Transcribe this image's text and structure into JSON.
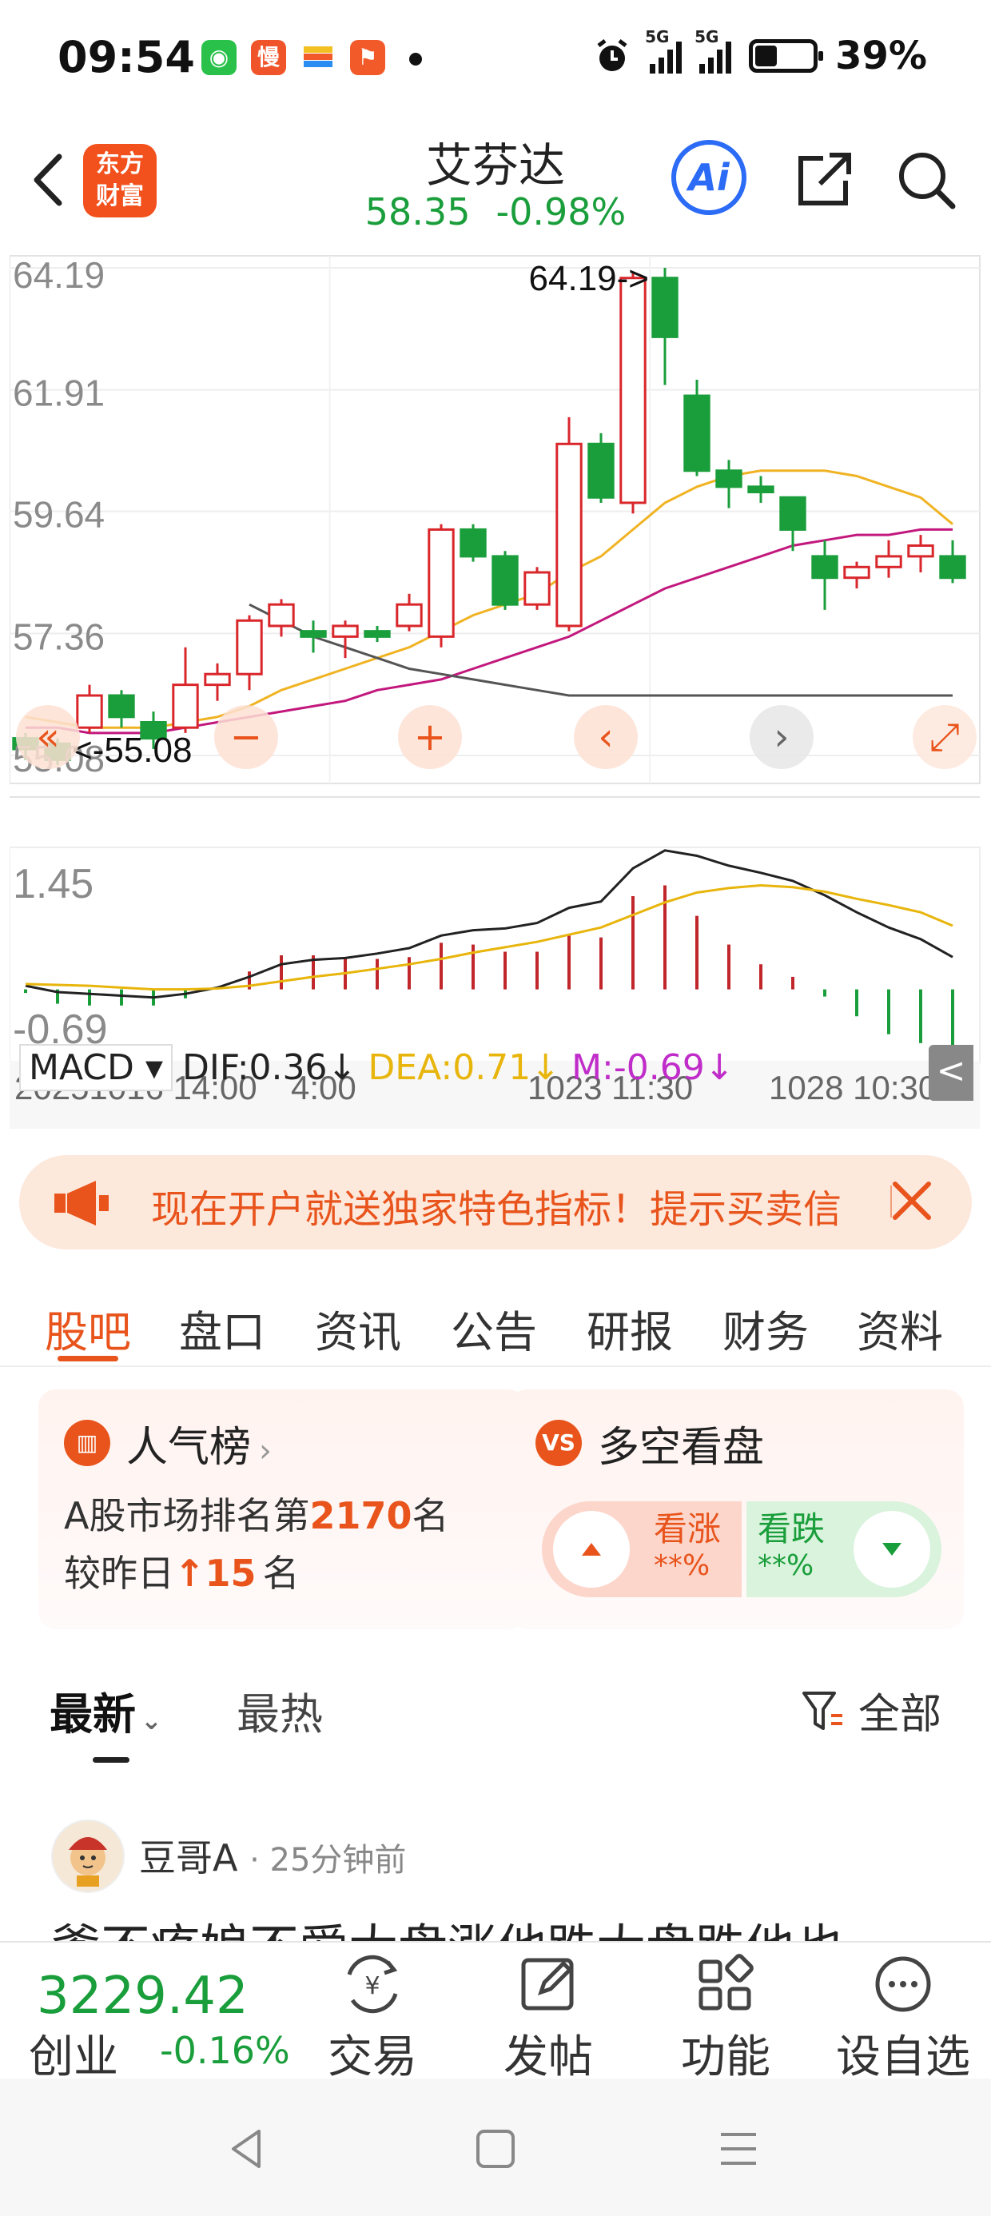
{
  "status_bar": {
    "time": "09:54",
    "apps": [
      "wechat",
      "慢",
      "wallet",
      "flag"
    ],
    "network": "5G",
    "battery": "39%",
    "battery_level": 0.39
  },
  "header": {
    "logo": [
      "东方",
      "财富"
    ],
    "stock_name": "艾芬达",
    "price": "58.35",
    "change_pct": "-0.98%",
    "ai_label": "Ai"
  },
  "chart": {
    "y_labels": [
      "64.19",
      "61.91",
      "59.64",
      "57.36",
      "55.08"
    ],
    "high_marker": "64.19->",
    "low_marker": "<-55.08",
    "macd_indicator": "MACD",
    "dif": "DIF:0.36↓",
    "dea": "DEA:0.71↓",
    "m": "M:-0.69↓",
    "macd_y_labels": [
      "1.45",
      "-0.69"
    ],
    "x_labels": [
      "20251016 14:00",
      "4:00",
      "1023 11:30",
      "1028 10:30"
    ],
    "toggle": "<"
  },
  "chart_data": {
    "type": "candlestick",
    "ylim": [
      55.08,
      64.19
    ],
    "candles": [
      {
        "o": 55.4,
        "c": 55.2,
        "h": 55.5,
        "l": 55.0
      },
      {
        "o": 55.3,
        "c": 55.0,
        "h": 55.4,
        "l": 54.9
      },
      {
        "o": 55.6,
        "c": 56.2,
        "h": 56.4,
        "l": 55.5
      },
      {
        "o": 56.2,
        "c": 55.8,
        "h": 56.3,
        "l": 55.6
      },
      {
        "o": 55.7,
        "c": 55.4,
        "h": 55.9,
        "l": 55.2
      },
      {
        "o": 55.6,
        "c": 56.4,
        "h": 57.1,
        "l": 55.5
      },
      {
        "o": 56.4,
        "c": 56.6,
        "h": 56.8,
        "l": 56.1
      },
      {
        "o": 56.6,
        "c": 57.6,
        "h": 57.7,
        "l": 56.3
      },
      {
        "o": 57.5,
        "c": 57.9,
        "h": 58.0,
        "l": 57.3
      },
      {
        "o": 57.4,
        "c": 57.3,
        "h": 57.6,
        "l": 57.0
      },
      {
        "o": 57.3,
        "c": 57.5,
        "h": 57.6,
        "l": 56.9
      },
      {
        "o": 57.4,
        "c": 57.3,
        "h": 57.5,
        "l": 57.2
      },
      {
        "o": 57.5,
        "c": 57.9,
        "h": 58.1,
        "l": 57.4
      },
      {
        "o": 57.3,
        "c": 59.3,
        "h": 59.4,
        "l": 57.1
      },
      {
        "o": 59.3,
        "c": 58.8,
        "h": 59.4,
        "l": 58.7
      },
      {
        "o": 58.8,
        "c": 57.9,
        "h": 58.9,
        "l": 57.8
      },
      {
        "o": 57.9,
        "c": 58.5,
        "h": 58.6,
        "l": 57.8
      },
      {
        "o": 57.5,
        "c": 60.9,
        "h": 61.4,
        "l": 57.4
      },
      {
        "o": 60.9,
        "c": 59.9,
        "h": 61.1,
        "l": 59.8
      },
      {
        "o": 59.8,
        "c": 64.0,
        "h": 64.1,
        "l": 59.6
      },
      {
        "o": 64.0,
        "c": 62.9,
        "h": 64.19,
        "l": 62.0
      },
      {
        "o": 61.8,
        "c": 60.4,
        "h": 62.1,
        "l": 60.3
      },
      {
        "o": 60.4,
        "c": 60.1,
        "h": 60.6,
        "l": 59.7
      },
      {
        "o": 60.1,
        "c": 60.0,
        "h": 60.3,
        "l": 59.8
      },
      {
        "o": 59.9,
        "c": 59.3,
        "h": 59.9,
        "l": 58.9
      },
      {
        "o": 58.8,
        "c": 58.4,
        "h": 59.1,
        "l": 57.8
      },
      {
        "o": 58.4,
        "c": 58.6,
        "h": 58.7,
        "l": 58.2
      },
      {
        "o": 58.6,
        "c": 58.8,
        "h": 59.1,
        "l": 58.4
      },
      {
        "o": 58.8,
        "c": 59.0,
        "h": 59.2,
        "l": 58.5
      },
      {
        "o": 58.8,
        "c": 58.4,
        "h": 59.1,
        "l": 58.3
      }
    ],
    "ma_series": [
      {
        "color": "#f0b323",
        "values": [
          55.8,
          55.7,
          55.6,
          55.6,
          55.6,
          55.7,
          55.8,
          56.0,
          56.3,
          56.5,
          56.7,
          56.9,
          57.1,
          57.4,
          57.7,
          57.9,
          58.1,
          58.5,
          58.8,
          59.3,
          59.8,
          60.1,
          60.3,
          60.4,
          60.4,
          60.4,
          60.3,
          60.1,
          59.9,
          59.4
        ]
      },
      {
        "color": "#c2187d",
        "values": [
          55.6,
          55.6,
          55.5,
          55.5,
          55.5,
          55.6,
          55.7,
          55.8,
          55.9,
          56.0,
          56.1,
          56.3,
          56.4,
          56.5,
          56.7,
          56.9,
          57.1,
          57.3,
          57.6,
          57.9,
          58.2,
          58.4,
          58.6,
          58.8,
          59.0,
          59.1,
          59.2,
          59.2,
          59.3,
          59.3
        ]
      },
      {
        "color": "#555555",
        "values": [
          null,
          null,
          null,
          null,
          null,
          null,
          null,
          57.9,
          57.6,
          57.3,
          57.1,
          56.9,
          56.7,
          56.6,
          56.5,
          56.4,
          56.3,
          56.2,
          56.2,
          56.2,
          56.2,
          56.2,
          56.2,
          56.2,
          56.2,
          56.2,
          56.2,
          56.2,
          56.2,
          56.2
        ]
      }
    ],
    "macd": {
      "ylim": [
        -0.69,
        1.45
      ],
      "dif": [
        0.04,
        -0.03,
        -0.05,
        -0.07,
        -0.09,
        -0.05,
        0.02,
        0.14,
        0.28,
        0.33,
        0.35,
        0.4,
        0.46,
        0.6,
        0.66,
        0.68,
        0.74,
        0.91,
        0.98,
        1.35,
        1.55,
        1.49,
        1.38,
        1.3,
        1.21,
        1.05,
        0.86,
        0.69,
        0.56,
        0.36
      ],
      "dea": [
        0.06,
        0.05,
        0.04,
        0.02,
        0.0,
        0.0,
        0.01,
        0.04,
        0.09,
        0.14,
        0.18,
        0.23,
        0.28,
        0.34,
        0.41,
        0.47,
        0.53,
        0.61,
        0.69,
        0.83,
        0.97,
        1.08,
        1.13,
        1.16,
        1.14,
        1.09,
        1.01,
        0.94,
        0.86,
        0.71
      ],
      "hist": [
        -0.04,
        -0.16,
        -0.18,
        -0.18,
        -0.18,
        -0.1,
        0.02,
        0.2,
        0.38,
        0.38,
        0.34,
        0.34,
        0.36,
        0.52,
        0.5,
        0.42,
        0.42,
        0.6,
        0.58,
        1.04,
        1.16,
        0.82,
        0.5,
        0.28,
        0.14,
        -0.08,
        -0.3,
        -0.5,
        -0.6,
        -0.69
      ]
    }
  },
  "promo": {
    "text": "现在开户就送独家特色指标！提示买卖信"
  },
  "tabs": [
    "股吧",
    "盘口",
    "资讯",
    "公告",
    "研报",
    "财务",
    "资料"
  ],
  "cards": {
    "popularity": {
      "title": "人气榜",
      "rank_prefix": "A股市场排名第",
      "rank": "2170",
      "rank_suffix": "名",
      "change_prefix": "较昨日",
      "change_arrow": "↑",
      "change_value": "15",
      "change_suffix": "名"
    },
    "sentiment": {
      "title": "多空看盘",
      "up_label": "看涨",
      "up_value": "**%",
      "down_label": "看跌",
      "down_value": "**%"
    }
  },
  "feed": {
    "tab_latest": "最新",
    "tab_hot": "最热",
    "filter": "全部"
  },
  "post": {
    "author": "豆哥A",
    "time": "· 25分钟前",
    "text": "爹不疼娘不爱大盘涨他跌大盘跌他也"
  },
  "bottom": {
    "index_value": "3229.42",
    "index_name": "创业",
    "index_change": "-0.16%",
    "nav": [
      "交易",
      "发帖",
      "功能",
      "设自选"
    ]
  }
}
